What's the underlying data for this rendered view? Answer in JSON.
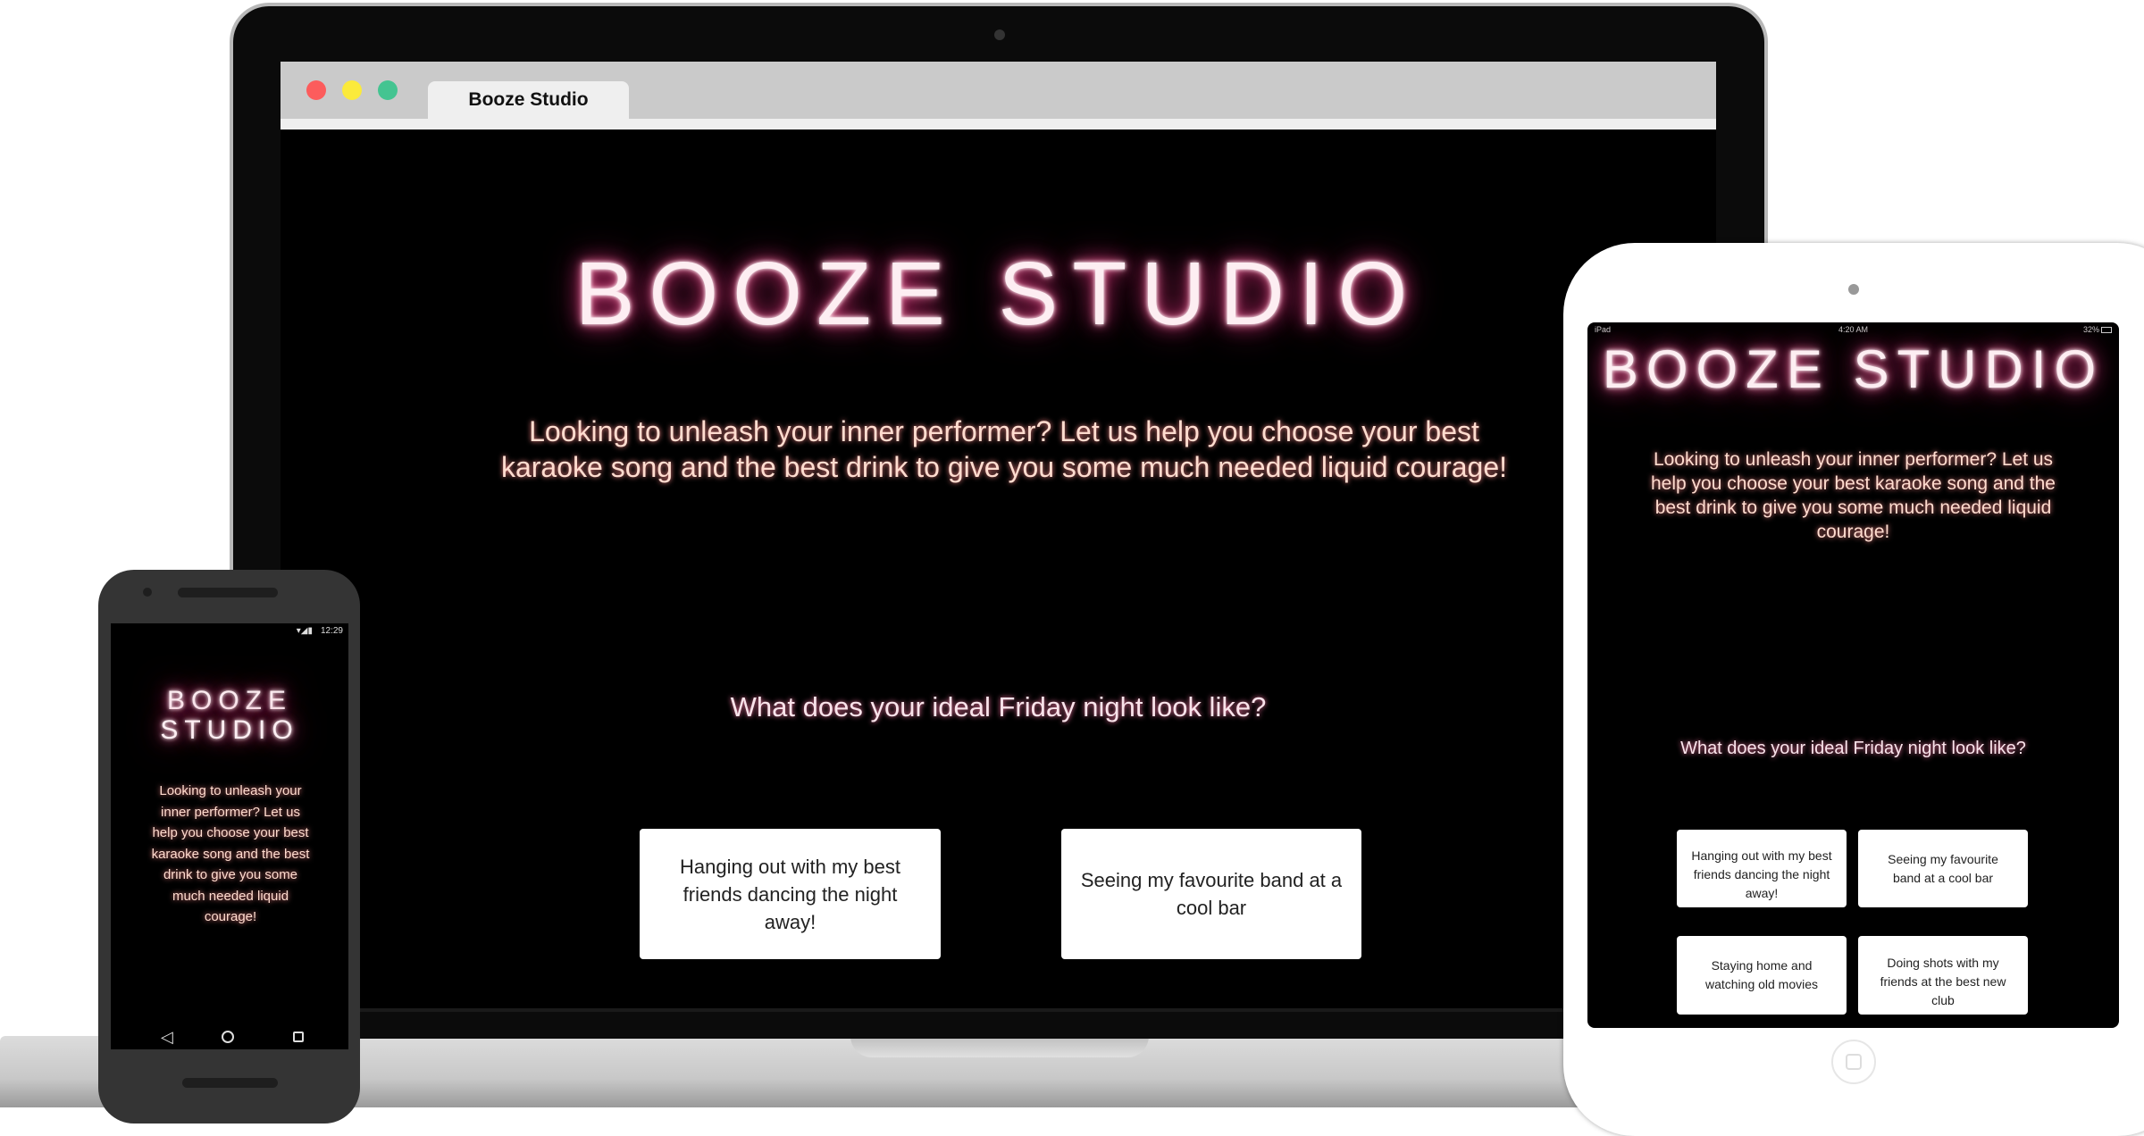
{
  "browser": {
    "tab_title": "Booze Studio",
    "colors": {
      "close": "#fc5c5c",
      "minimize": "#fbea3b",
      "maximize": "#44c491"
    }
  },
  "site": {
    "title": "BOOZE STUDIO",
    "title_line1": "BOOZE",
    "title_line2": "STUDIO",
    "intro": "Looking to unleash your inner performer? Let us help you choose your best karaoke song and the best drink to give you some much needed liquid courage!",
    "question": "What does your ideal Friday night look like?",
    "options": [
      "Hanging out with my best friends dancing the night away!",
      "Seeing my favourite band at a cool bar",
      "Staying home and watching old movies",
      "Doing shots with my friends at the best new club"
    ]
  },
  "tablet_status": {
    "device": "iPad",
    "time": "4:20 AM",
    "battery": "32%"
  },
  "phone_status": {
    "time": "12:29"
  }
}
